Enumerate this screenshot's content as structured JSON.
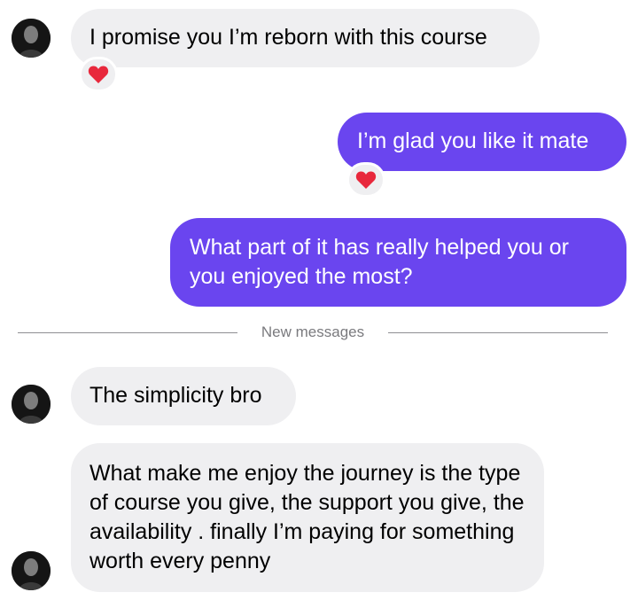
{
  "messages": [
    {
      "from": "them",
      "text": "I promise you I’m reborn with this course",
      "reaction": "heart"
    },
    {
      "from": "me",
      "text": "I’m glad you like it mate",
      "reaction": "heart"
    },
    {
      "from": "me",
      "text": "What part of it has really helped you or you enjoyed the most?"
    },
    {
      "from": "them",
      "text": "The simplicity bro"
    },
    {
      "from": "them",
      "text": "What make me enjoy the journey is the type of course you give, the support you give, the availability . finally I’m paying for something worth every penny"
    }
  ],
  "divider": {
    "label": "New messages"
  },
  "colors": {
    "outgoing_bubble": "#6a45ef",
    "incoming_bubble": "#efeff1",
    "reaction_heart": "#e8283c"
  },
  "icons": {
    "reaction": "heart-icon"
  }
}
